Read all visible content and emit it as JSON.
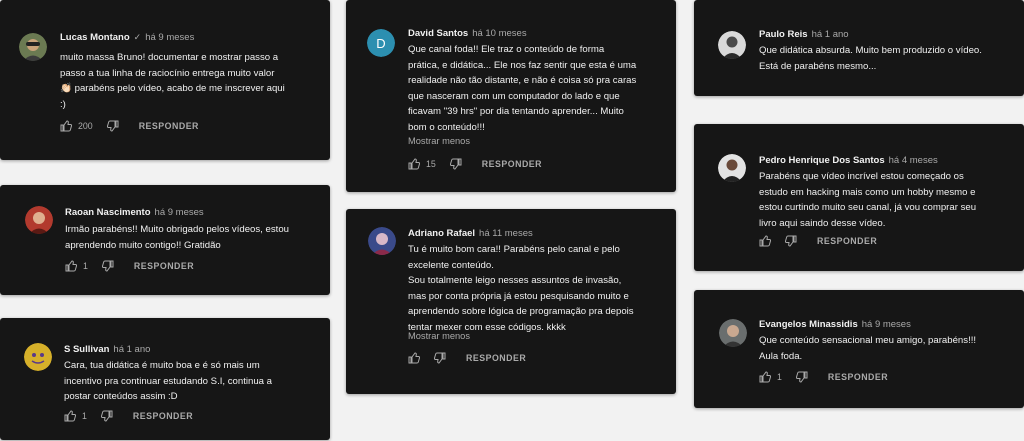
{
  "reply_label": "RESPONDER",
  "show_less_label": "Mostrar menos",
  "comments": [
    {
      "author": "Lucas Montano",
      "verified": "✓",
      "time": "há 9 meses",
      "text": "muito massa Bruno! documentar e mostrar passo a\npasso a tua linha de raciocínio entrega muito valor\n👏🏻 parabéns pelo vídeo, acabo de me inscrever aqui\n:)",
      "likes": "200",
      "avatar_color": "#6b7a52"
    },
    {
      "author": "Raoan Nascimento",
      "time": "há 9 meses",
      "text": "Irmão parabéns!! Muito obrigado pelos vídeos, estou\naprendendo muito contigo!! Gratidão",
      "likes": "1",
      "avatar_color": "#b23a2e"
    },
    {
      "author": "S Sullivan",
      "time": "há 1 ano",
      "text": "Cara, tua didática é muito boa e é só mais um\nincentivo pra continuar estudando S.I, continua a\npostar conteúdos assim :D",
      "likes": "1",
      "avatar_color": "#d6b02a"
    },
    {
      "author": "David Santos",
      "time": "há 10 meses",
      "text": "Que canal foda!! Ele traz o conteúdo de forma\nprática, e didática... Ele nos faz sentir que esta é uma\nrealidade não tão distante, e não é coisa só pra caras\nque nasceram com um computador do lado e que\nficavam \"39 hrs\" por dia tentando aprender... Muito\nbom o conteúdo!!!",
      "likes": "15",
      "avatar_letter": "D",
      "avatar_color": "#2c8fb0"
    },
    {
      "author": "Adriano Rafael",
      "time": "há 11 meses",
      "text": "Tu é muito bom cara!! Parabéns pelo canal e pelo\nexcelente conteúdo.\nSou totalmente leigo nesses assuntos de invasão,\nmas por conta própria já estou pesquisando muito e\naprendendo sobre lógica de programação pra depois\ntentar mexer com esse códigos. kkkk",
      "avatar_color": "#3a4a8a"
    },
    {
      "author": "Paulo Reis",
      "time": "há 1 ano",
      "text": "Que didática absurda. Muito bem produzido o vídeo.\nEstá de parabéns mesmo...",
      "avatar_color": "#d9d9d9"
    },
    {
      "author": "Pedro Henrique Dos Santos",
      "time": "há 4 meses",
      "text": "Parabéns que vídeo incrível estou começado os\nestudo em hacking mais como um hobby mesmo e\nestou curtindo muito seu canal, já vou comprar seu\nlivro aqui saindo desse vídeo.",
      "avatar_color": "#e3e3e3"
    },
    {
      "author": "Evangelos Minassidis",
      "time": "há 9 meses",
      "text": "Que conteúdo sensacional meu amigo, parabéns!!!\nAula foda.",
      "likes": "1",
      "avatar_color": "#6a6e6e"
    }
  ]
}
